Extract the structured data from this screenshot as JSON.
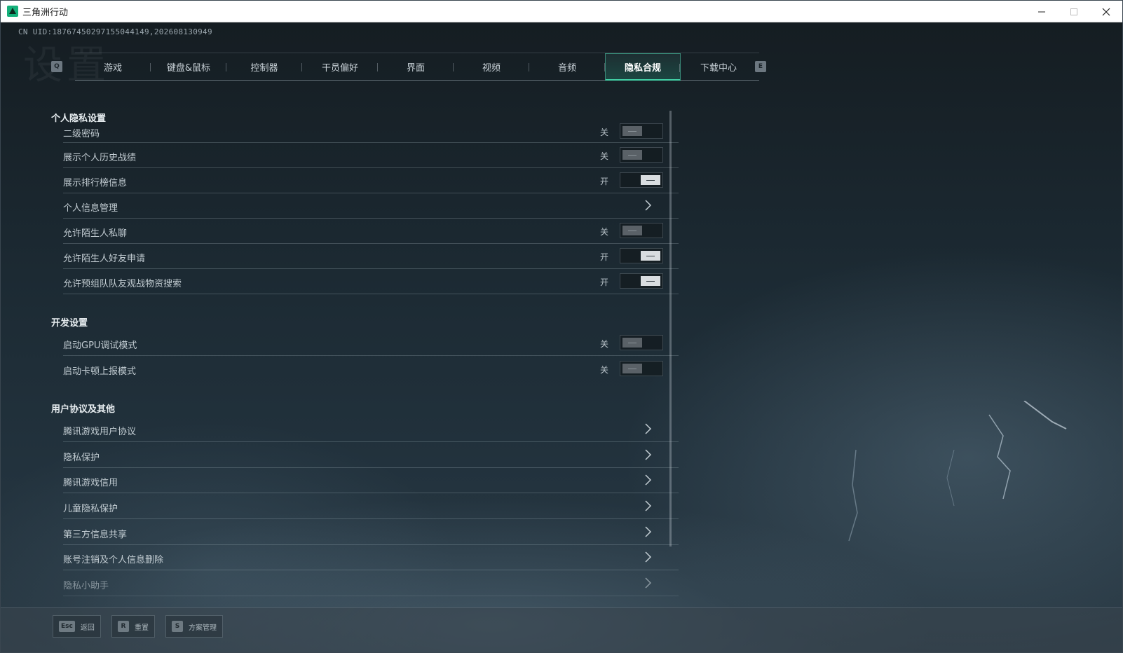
{
  "window": {
    "title": "三角洲行动"
  },
  "header": {
    "uid": "CN UID:18767450297155044149,202608130949",
    "watermark": "设置"
  },
  "tabs": {
    "prev_key": "Q",
    "next_key": "E",
    "items": [
      {
        "label": "游戏"
      },
      {
        "label": "键盘&鼠标"
      },
      {
        "label": "控制器"
      },
      {
        "label": "干员偏好"
      },
      {
        "label": "界面"
      },
      {
        "label": "视频"
      },
      {
        "label": "音频"
      },
      {
        "label": "隐私合规",
        "active": true
      },
      {
        "label": "下载中心"
      }
    ]
  },
  "sections": {
    "privacy": {
      "title": "个人隐私设置",
      "items": [
        {
          "label": "二级密码",
          "state": "关",
          "type": "toggle",
          "on": false
        },
        {
          "label": "展示个人历史战绩",
          "state": "关",
          "type": "toggle",
          "on": false
        },
        {
          "label": "展示排行榜信息",
          "state": "开",
          "type": "toggle",
          "on": true
        },
        {
          "label": "个人信息管理",
          "type": "link"
        },
        {
          "label": "允许陌生人私聊",
          "state": "关",
          "type": "toggle",
          "on": false
        },
        {
          "label": "允许陌生人好友申请",
          "state": "开",
          "type": "toggle",
          "on": true
        },
        {
          "label": "允许预组队队友观战物资搜索",
          "state": "开",
          "type": "toggle",
          "on": true
        }
      ]
    },
    "dev": {
      "title": "开发设置",
      "items": [
        {
          "label": "启动GPU调试模式",
          "state": "关",
          "type": "toggle",
          "on": false
        },
        {
          "label": "启动卡顿上报模式",
          "state": "关",
          "type": "toggle",
          "on": false
        }
      ]
    },
    "agreements": {
      "title": "用户协议及其他",
      "items": [
        {
          "label": "腾讯游戏用户协议",
          "type": "link"
        },
        {
          "label": "隐私保护",
          "type": "link"
        },
        {
          "label": "腾讯游戏信用",
          "type": "link"
        },
        {
          "label": "儿童隐私保护",
          "type": "link"
        },
        {
          "label": "第三方信息共享",
          "type": "link"
        },
        {
          "label": "账号注销及个人信息删除",
          "type": "link"
        },
        {
          "label": "隐私小助手",
          "type": "link"
        }
      ]
    }
  },
  "footer": {
    "buttons": [
      {
        "key": "Esc",
        "label": "返回"
      },
      {
        "key": "R",
        "label": "重置"
      },
      {
        "key": "S",
        "label": "方案管理"
      }
    ]
  }
}
